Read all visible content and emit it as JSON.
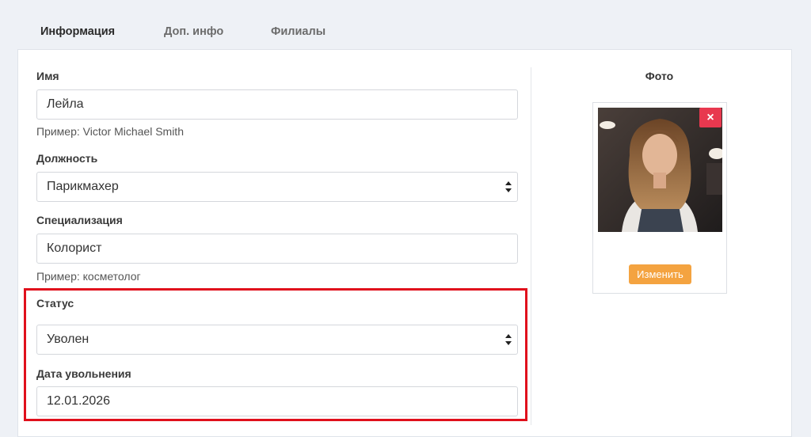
{
  "tabs": [
    {
      "label": "Информация",
      "active": true
    },
    {
      "label": "Доп. инфо",
      "active": false
    },
    {
      "label": "Филиалы",
      "active": false
    }
  ],
  "form": {
    "name": {
      "label": "Имя",
      "value": "Лейла",
      "hint": "Пример: Victor Michael Smith"
    },
    "position": {
      "label": "Должность",
      "value": "Парикмахер"
    },
    "specialization": {
      "label": "Специализация",
      "value": "Колорист",
      "hint": "Пример: косметолог"
    },
    "status": {
      "label": "Статус",
      "value": "Уволен"
    },
    "dismissal_date": {
      "label": "Дата увольнения",
      "value": "12.01.2026"
    }
  },
  "photo": {
    "title": "Фото",
    "delete_icon": "×",
    "change_label": "Изменить"
  },
  "colors": {
    "highlight": "#e0101c",
    "delete": "#e8384f",
    "change": "#f4a340",
    "background": "#eef1f6"
  }
}
